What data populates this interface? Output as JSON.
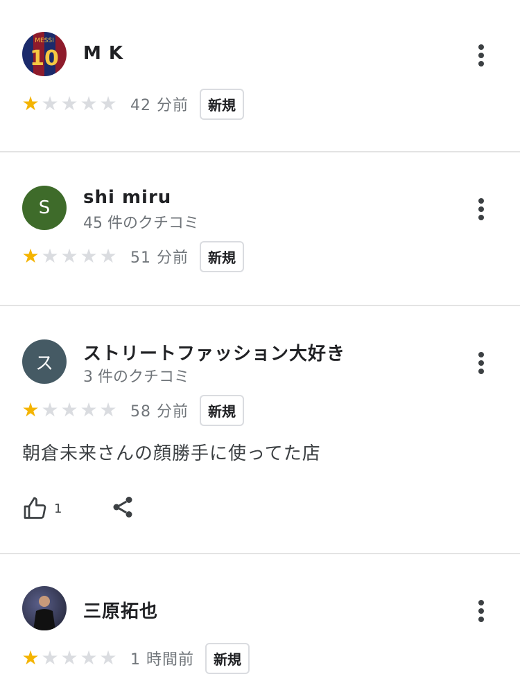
{
  "reviews": [
    {
      "avatar_type": "photo",
      "avatar_photo_text": "10",
      "avatar_photo_caption": "MESSI",
      "avatar_color": "#7a1f2c",
      "name": "M K",
      "subtitle": "",
      "rating": 1,
      "time": "42 分前",
      "badge": "新規"
    },
    {
      "avatar_type": "letter",
      "avatar_letter": "S",
      "avatar_color": "#3e6b2a",
      "name": "shi miru",
      "subtitle": "45 件のクチコミ",
      "rating": 1,
      "time": "51 分前",
      "badge": "新規"
    },
    {
      "avatar_type": "letter",
      "avatar_letter": "ス",
      "avatar_color": "#455a64",
      "name": "ストリートファッション大好き",
      "subtitle": "3 件のクチコミ",
      "rating": 1,
      "time": "58 分前",
      "badge": "新規",
      "text": "朝倉未来さんの顔勝手に使ってた店",
      "likes": "1"
    },
    {
      "avatar_type": "photo",
      "avatar_color": "#2b2b3a",
      "name": "三原拓也",
      "subtitle": "",
      "rating": 1,
      "time": "1 時間前",
      "badge": "新規"
    }
  ],
  "colors": {
    "star_filled": "#f4b400",
    "star_empty": "#dadce0",
    "divider": "#e3e3e3"
  },
  "icons": {
    "menu": "more-vert-icon",
    "like": "thumb-up-icon",
    "share": "share-icon",
    "star": "star-icon"
  }
}
